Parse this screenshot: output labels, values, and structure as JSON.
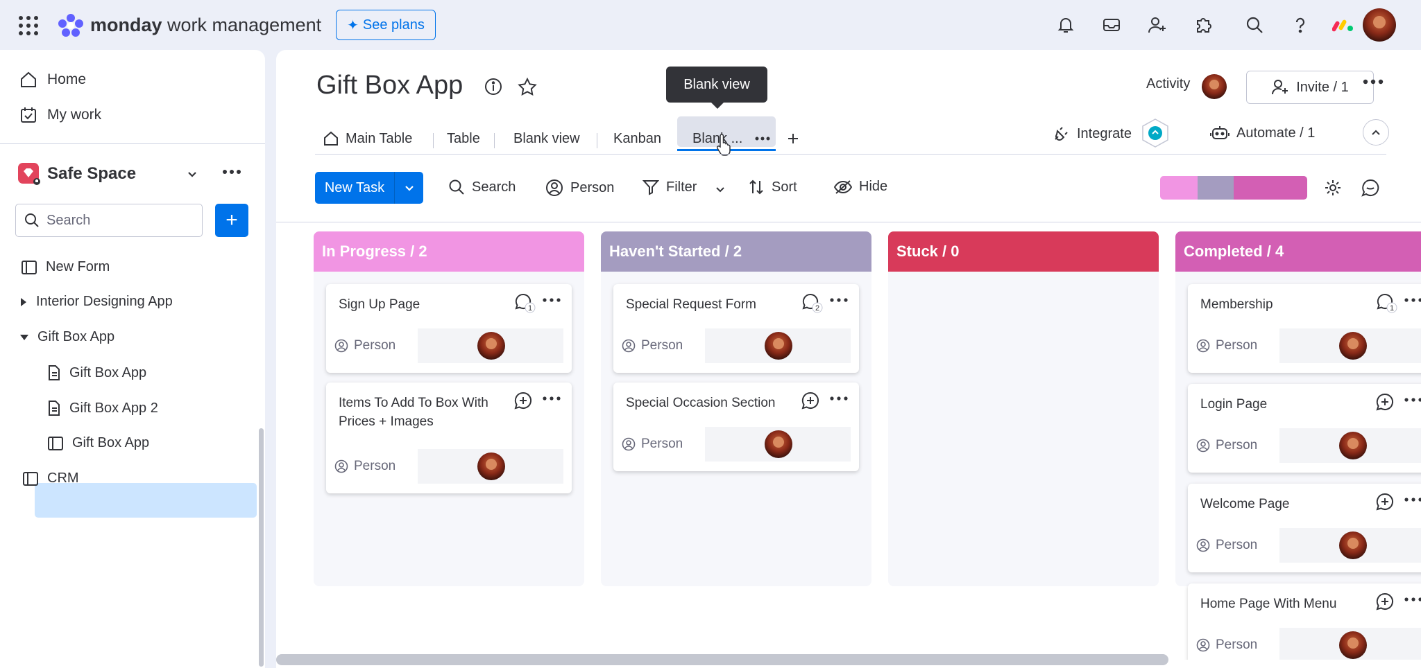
{
  "topbar": {
    "brand_bold": "monday",
    "brand_rest": " work management",
    "see_plans": "See plans"
  },
  "sidebar": {
    "home": "Home",
    "my_work": "My work",
    "workspace": "Safe Space",
    "search_placeholder": "Search",
    "tree": [
      "New Form",
      "Interior Designing App",
      "Gift Box App",
      "Gift Box App",
      "Gift Box App 2",
      "Gift Box App",
      "CRM"
    ]
  },
  "board": {
    "title": "Gift Box App",
    "tooltip": "Blank view",
    "activity": "Activity",
    "invite": "Invite / 1",
    "tabs": [
      "Main Table",
      "Table",
      "Blank view",
      "Kanban",
      "Blank ..."
    ],
    "integrate": "Integrate",
    "automate": "Automate / 1"
  },
  "toolbar": {
    "new_task": "New Task",
    "search": "Search",
    "person": "Person",
    "filter": "Filter",
    "sort": "Sort",
    "hide": "Hide"
  },
  "colors": {
    "in_progress": "#f195e3",
    "not_started": "#a49cc0",
    "stuck": "#d83a5a",
    "completed": "#d35fb4",
    "accent": "#0073ea"
  },
  "columns": [
    {
      "header": "In Progress / 2",
      "cards": [
        {
          "title": "Sign Up Page",
          "updates": "1",
          "person": "Person"
        },
        {
          "title": "Items To Add To Box With Prices + Images",
          "updates": "",
          "person": "Person"
        }
      ]
    },
    {
      "header": "Haven't Started / 2",
      "cards": [
        {
          "title": "Special Request Form",
          "updates": "2",
          "person": "Person"
        },
        {
          "title": "Special Occasion Section",
          "updates": "",
          "person": "Person"
        }
      ]
    },
    {
      "header": "Stuck / 0",
      "cards": []
    },
    {
      "header": "Completed / 4",
      "cards": [
        {
          "title": "Membership",
          "updates": "1",
          "person": "Person"
        },
        {
          "title": "Login Page",
          "updates": "",
          "person": "Person"
        },
        {
          "title": "Welcome Page",
          "updates": "",
          "person": "Person"
        },
        {
          "title": "Home Page With Menu",
          "updates": "",
          "person": "Person"
        }
      ]
    }
  ]
}
